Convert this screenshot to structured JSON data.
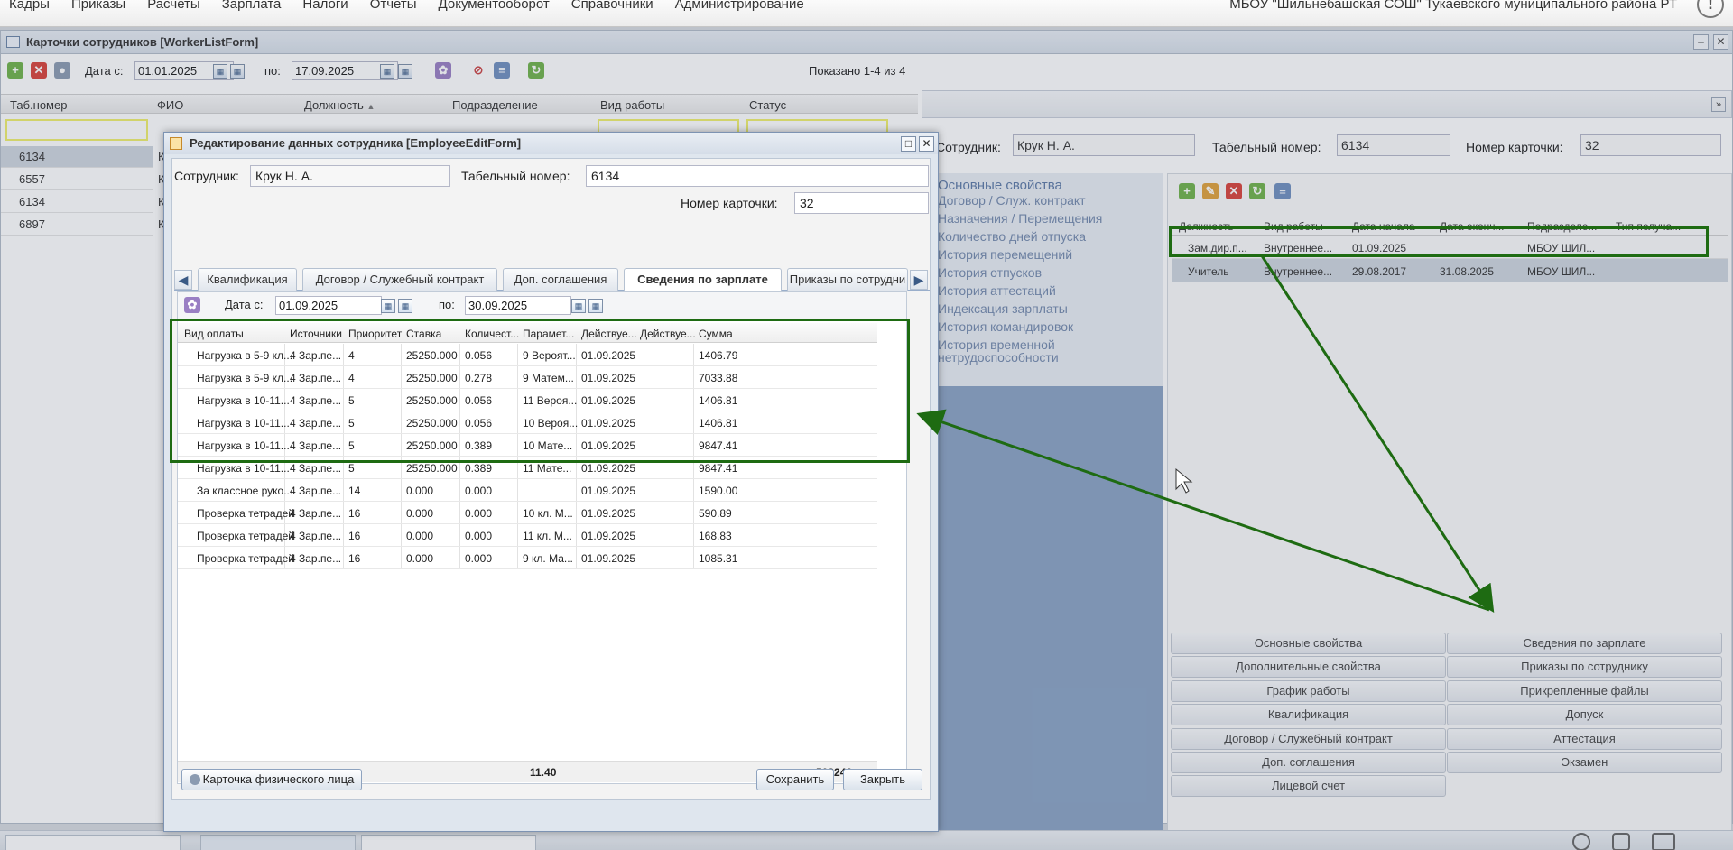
{
  "menu": [
    "Кадры",
    "Приказы",
    "Расчеты",
    "Зарплата",
    "Налоги",
    "Отчеты",
    "Документооборот",
    "Справочники",
    "Администрирование"
  ],
  "organization": "МБОУ \"Шильнебашская СОШ\" Тукаевского муниципального района РТ",
  "worker_window": {
    "title": "Карточки сотрудников [WorkerListForm]",
    "date_from_label": "Дата с:",
    "date_from": "01.01.2025",
    "date_to_label": "по:",
    "date_to": "17.09.2025",
    "shown": "Показано 1-4 из 4",
    "columns": [
      "Таб.номер",
      "ФИО",
      "Должность",
      "Подразделение",
      "Вид работы",
      "Статус"
    ],
    "sort_indicator": "▲",
    "rows": [
      {
        "tab": "6134",
        "fio": "К"
      },
      {
        "tab": "6557",
        "fio": "К"
      },
      {
        "tab": "6134",
        "fio": "К"
      },
      {
        "tab": "6897",
        "fio": "К"
      }
    ]
  },
  "right_panel": {
    "employee_label": "Сотрудник:",
    "employee": "Крук Н. А.",
    "tabnum_label": "Табельный номер:",
    "tabnum": "6134",
    "card_label": "Номер карточки:",
    "card": "32",
    "nav": [
      "Основные свойства",
      "Договор / Служ. контракт",
      "Назначения / Перемещения",
      "Количество дней отпуска",
      "История перемещений",
      "История отпусков",
      "История аттестаций",
      "Индексация зарплаты",
      "История командировок",
      "История временной",
      "нетрудоспособности"
    ],
    "grid_columns": [
      "Должность",
      "Вид работы",
      "Дата начала",
      "Дата оконч...",
      "Подразделе...",
      "Тип получа..."
    ],
    "grid_rows": [
      {
        "pos": "Зам.дир.п...",
        "work": "Внутреннее...",
        "start": "01.09.2025",
        "end": "",
        "dept": "МБОУ ШИЛ...",
        "type": ""
      },
      {
        "pos": "Учитель",
        "work": "Внутреннее...",
        "start": "29.08.2017",
        "end": "31.08.2025",
        "dept": "МБОУ ШИЛ...",
        "type": ""
      }
    ],
    "buttons_left": [
      "Основные свойства",
      "Дополнительные свойства",
      "График работы",
      "Квалификация",
      "Договор / Служебный контракт",
      "Доп. соглашения",
      "Лицевой счет"
    ],
    "buttons_right": [
      "Сведения по зарплате",
      "Приказы по сотруднику",
      "Прикрепленные файлы",
      "Допуск",
      "Аттестация",
      "Экзамен"
    ]
  },
  "modal": {
    "title": "Редактирование данных сотрудника [EmployeeEditForm]",
    "employee_label": "Сотрудник:",
    "employee": "Крук Н. А.",
    "tabnum_label": "Табельный номер:",
    "tabnum": "6134",
    "card_label": "Номер карточки:",
    "card": "32",
    "tabs": [
      "Квалификация",
      "Договор / Служебный контракт",
      "Доп. соглашения",
      "Сведения по зарплате",
      "Приказы по сотрудни"
    ],
    "active_tab": "Сведения по зарплате",
    "date_from_label": "Дата с:",
    "date_from": "01.09.2025",
    "date_to_label": "по:",
    "date_to": "30.09.2025",
    "columns": [
      "Вид оплаты",
      "Источники",
      "Приоритет",
      "Ставка",
      "Количест...",
      "Парамет...",
      "Действуе...",
      "Действуе...",
      "Сумма"
    ],
    "rows": [
      [
        "Нагрузка в 5-9 кл...",
        "4 Зар.пе...",
        "4",
        "25250.000",
        "0.056",
        "9 Вероят...",
        "01.09.2025",
        "",
        "1406.79"
      ],
      [
        "Нагрузка в 5-9 кл...",
        "4 Зар.пе...",
        "4",
        "25250.000",
        "0.278",
        "9 Матем...",
        "01.09.2025",
        "",
        "7033.88"
      ],
      [
        "Нагрузка в 10-11...",
        "4 Зар.пе...",
        "5",
        "25250.000",
        "0.056",
        "11 Вероя...",
        "01.09.2025",
        "",
        "1406.81"
      ],
      [
        "Нагрузка в 10-11...",
        "4 Зар.пе...",
        "5",
        "25250.000",
        "0.056",
        "10 Вероя...",
        "01.09.2025",
        "",
        "1406.81"
      ],
      [
        "Нагрузка в 10-11...",
        "4 Зар.пе...",
        "5",
        "25250.000",
        "0.389",
        "10 Мате...",
        "01.09.2025",
        "",
        "9847.41"
      ],
      [
        "Нагрузка в 10-11...",
        "4 Зар.пе...",
        "5",
        "25250.000",
        "0.389",
        "11 Мате...",
        "01.09.2025",
        "",
        "9847.41"
      ],
      [
        "За классное руко...",
        "4 Зар.пе...",
        "14",
        "0.000",
        "0.000",
        "",
        "01.09.2025",
        "",
        "1590.00"
      ],
      [
        "Проверка тетрадей",
        "4 Зар.пе...",
        "16",
        "0.000",
        "0.000",
        "10 кл. М...",
        "01.09.2025",
        "",
        "590.89"
      ],
      [
        "Проверка тетрадей",
        "4 Зар.пе...",
        "16",
        "0.000",
        "0.000",
        "11 кл. М...",
        "01.09.2025",
        "",
        "168.83"
      ],
      [
        "Проверка тетрадей",
        "4 Зар.пе...",
        "16",
        "0.000",
        "0.000",
        "9 кл. Ма...",
        "01.09.2025",
        "",
        "1085.31"
      ]
    ],
    "total_qty": "11.40",
    "total_sum": "502246...",
    "person_card_button": "Карточка физического лица",
    "save_button": "Сохранить",
    "close_button": "Закрыть"
  },
  "colors": {
    "highlight": "#1e6b12",
    "selected_row": "#cfd6de",
    "filter_border": "#f0f06c"
  }
}
